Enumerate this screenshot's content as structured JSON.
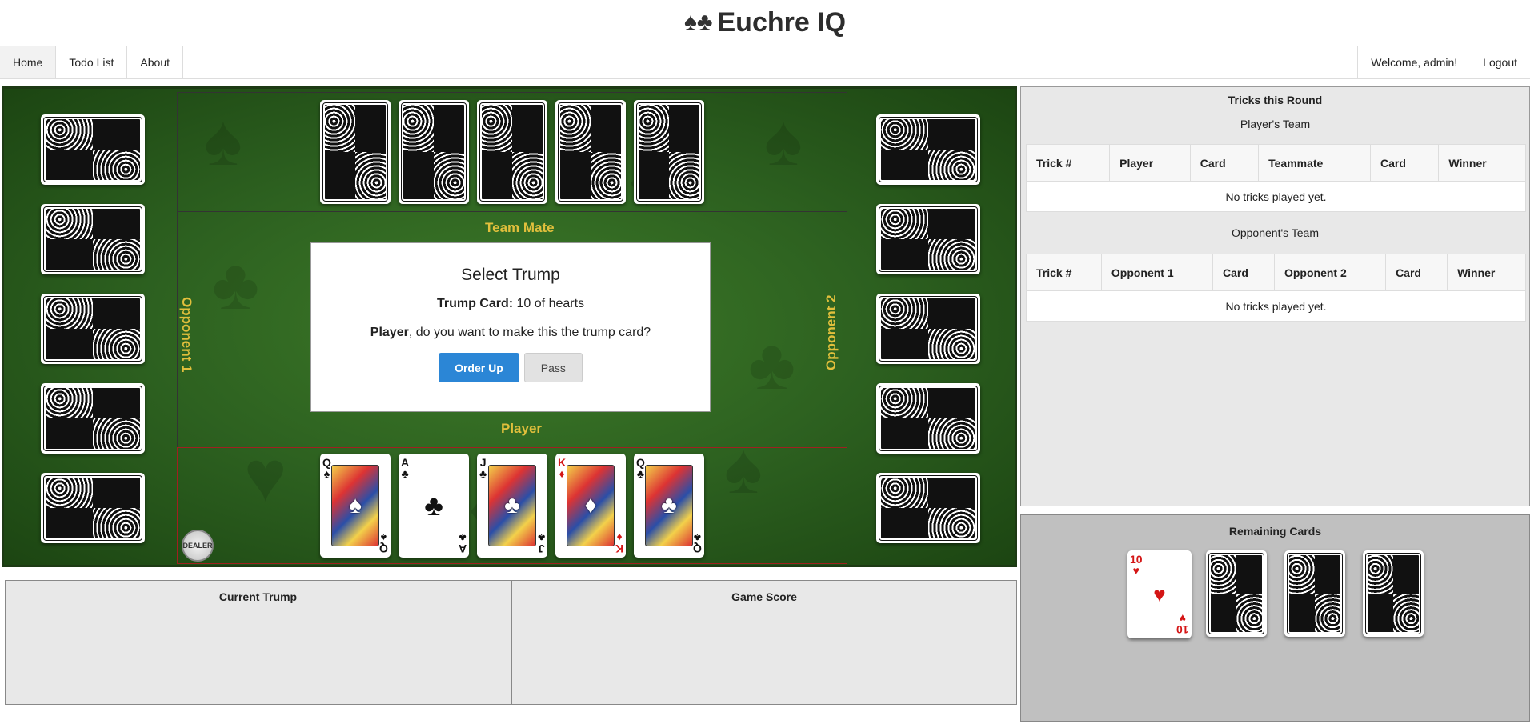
{
  "header": {
    "title": "Euchre IQ",
    "logo_icon": "♠♣"
  },
  "nav": {
    "left": [
      {
        "label": "Home",
        "active": true
      },
      {
        "label": "Todo List",
        "active": false
      },
      {
        "label": "About",
        "active": false
      }
    ],
    "welcome": "Welcome, admin!",
    "logout": "Logout"
  },
  "board": {
    "team_mate_label": "Team Mate",
    "player_label": "Player",
    "opponent1_label": "Opponent 1",
    "opponent2_label": "Opponent 2",
    "dealer_chip": "DEALER",
    "player_hand": [
      {
        "rank": "Q",
        "suit": "♠",
        "color": "black",
        "royal": true
      },
      {
        "rank": "A",
        "suit": "♣",
        "color": "black",
        "royal": false
      },
      {
        "rank": "J",
        "suit": "♣",
        "color": "black",
        "royal": true
      },
      {
        "rank": "K",
        "suit": "♦",
        "color": "red",
        "royal": true
      },
      {
        "rank": "Q",
        "suit": "♣",
        "color": "black",
        "royal": true
      }
    ]
  },
  "modal": {
    "title": "Select Trump",
    "trump_label": "Trump Card:",
    "trump_value": "10 of hearts",
    "question_name": "Player",
    "question_text": ", do you want to make this the trump card?",
    "order_up": "Order Up",
    "pass": "Pass"
  },
  "bottom": {
    "current_trump": "Current Trump",
    "game_score": "Game Score"
  },
  "tricks": {
    "title": "Tricks this Round",
    "players_team": "Player's Team",
    "players_columns": [
      "Trick #",
      "Player",
      "Card",
      "Teammate",
      "Card",
      "Winner"
    ],
    "players_empty": "No tricks played yet.",
    "opponents_team": "Opponent's Team",
    "opponents_columns": [
      "Trick #",
      "Opponent 1",
      "Card",
      "Opponent 2",
      "Card",
      "Winner"
    ],
    "opponents_empty": "No tricks played yet."
  },
  "remaining": {
    "title": "Remaining Cards",
    "face_card": {
      "rank": "10",
      "suit": "♥",
      "color": "red"
    }
  }
}
